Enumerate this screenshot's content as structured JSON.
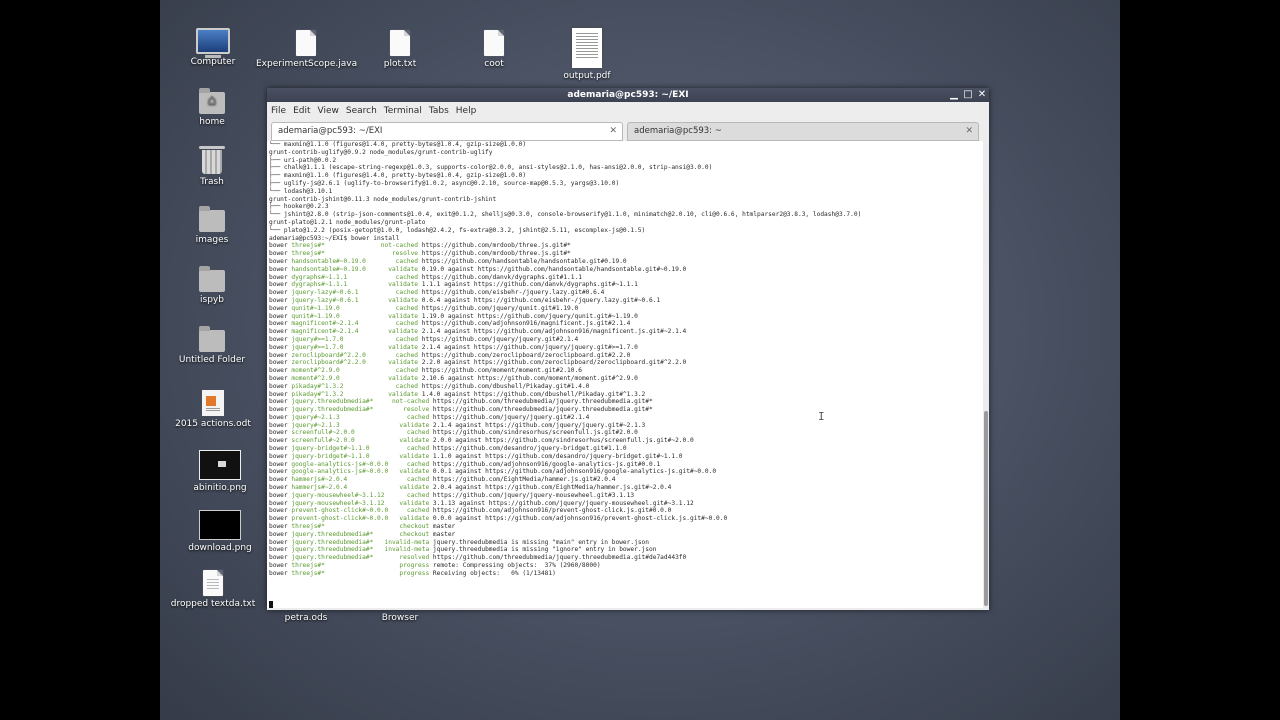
{
  "desktop": {
    "icons": [
      {
        "label": "Computer"
      },
      {
        "label": "home"
      },
      {
        "label": "Trash"
      },
      {
        "label": "images"
      },
      {
        "label": "ispyb"
      },
      {
        "label": "Untitled Folder"
      },
      {
        "label": "2015 actions.odt"
      },
      {
        "label": "abinitio.png"
      },
      {
        "label": "download.png"
      },
      {
        "label": "dropped textda.txt"
      },
      {
        "label": "ExperimentScope.java"
      },
      {
        "label": "plot.txt"
      },
      {
        "label": "coot"
      },
      {
        "label": "output.pdf"
      },
      {
        "label": "petra.ods"
      },
      {
        "label": "Browser"
      }
    ]
  },
  "window": {
    "title": "ademaria@pc593: ~/EXI",
    "controls": [
      "▁",
      "□",
      "✕"
    ],
    "menu": [
      "File",
      "Edit",
      "View",
      "Search",
      "Terminal",
      "Tabs",
      "Help"
    ],
    "tabs": [
      {
        "label": "ademaria@pc593: ~/EXI",
        "active": true
      },
      {
        "label": "ademaria@pc593: ~",
        "active": false
      }
    ]
  },
  "terminal": {
    "lines": [
      [
        "└── maxmin@1.1.0 (figures@1.4.0, pretty-bytes@1.0.4, gzip-size@1.0.0)",
        "",
        ""
      ],
      [
        "",
        "",
        ""
      ],
      [
        "grunt-contrib-uglify@0.9.2 node_modules/grunt-contrib-uglify",
        "",
        ""
      ],
      [
        "├── uri-path@0.0.2",
        "",
        ""
      ],
      [
        "├── chalk@1.1.1 (escape-string-regexp@1.0.3, supports-color@2.0.0, ansi-styles@2.1.0, has-ansi@2.0.0, strip-ansi@3.0.0)",
        "",
        ""
      ],
      [
        "├── maxmin@1.1.0 (figures@1.4.0, pretty-bytes@1.0.4, gzip-size@1.0.0)",
        "",
        ""
      ],
      [
        "├── uglify-js@2.6.1 (uglify-to-browserify@1.0.2, async@0.2.10, source-map@0.5.3, yargs@3.10.0)",
        "",
        ""
      ],
      [
        "└── lodash@3.10.1",
        "",
        ""
      ],
      [
        "",
        "",
        ""
      ],
      [
        "grunt-contrib-jshint@0.11.3 node_modules/grunt-contrib-jshint",
        "",
        ""
      ],
      [
        "├── hooker@0.2.3",
        "",
        ""
      ],
      [
        "└── jshint@2.8.0 (strip-json-comments@1.0.4, exit@0.1.2, shelljs@0.3.0, console-browserify@1.1.0, minimatch@2.0.10, cli@0.6.6, htmlparser2@3.8.3, lodash@3.7.0)",
        "",
        ""
      ],
      [
        "",
        "",
        ""
      ],
      [
        "grunt-plato@1.2.1 node_modules/grunt-plato",
        "",
        ""
      ],
      [
        "└── plato@1.2.2 (posix-getopt@1.0.0, lodash@2.4.2, fs-extra@0.3.2, jshint@2.5.11, escomplex-js@0.1.5)",
        "",
        ""
      ],
      [
        "ademaria@pc593:~/EXI$ bower install",
        "",
        ""
      ],
      [
        "bower ",
        "threejs#*               not-cached",
        " https://github.com/mrdoob/three.js.git#*"
      ],
      [
        "bower ",
        "threejs#*                  resolve",
        " https://github.com/mrdoob/three.js.git#*"
      ],
      [
        "bower ",
        "handsontable#~0.19.0        cached",
        " https://github.com/handsontable/handsontable.git#0.19.0"
      ],
      [
        "bower ",
        "handsontable#~0.19.0      validate",
        " 0.19.0 against https://github.com/handsontable/handsontable.git#~0.19.0"
      ],
      [
        "bower ",
        "dygraphs#~1.1.1             cached",
        " https://github.com/danvk/dygraphs.git#1.1.1"
      ],
      [
        "bower ",
        "dygraphs#~1.1.1           validate",
        " 1.1.1 against https://github.com/danvk/dygraphs.git#~1.1.1"
      ],
      [
        "bower ",
        "jquery-lazy#~0.6.1          cached",
        " https://github.com/eisbehr-/jquery.lazy.git#0.6.4"
      ],
      [
        "bower ",
        "jquery-lazy#~0.6.1        validate",
        " 0.6.4 against https://github.com/eisbehr-/jquery.lazy.git#~0.6.1"
      ],
      [
        "bower ",
        "qunit#~1.19.0               cached",
        " https://github.com/jquery/qunit.git#1.19.0"
      ],
      [
        "bower ",
        "qunit#~1.19.0             validate",
        " 1.19.0 against https://github.com/jquery/qunit.git#~1.19.0"
      ],
      [
        "bower ",
        "magnificent#~2.1.4          cached",
        " https://github.com/adjohnson916/magnificent.js.git#2.1.4"
      ],
      [
        "bower ",
        "magnificent#~2.1.4        validate",
        " 2.1.4 against https://github.com/adjohnson916/magnificent.js.git#~2.1.4"
      ],
      [
        "bower ",
        "jquery#>=1.7.0              cached",
        " https://github.com/jquery/jquery.git#2.1.4"
      ],
      [
        "bower ",
        "jquery#>=1.7.0            validate",
        " 2.1.4 against https://github.com/jquery/jquery.git#>=1.7.0"
      ],
      [
        "bower ",
        "zeroclipboard#^2.2.0        cached",
        " https://github.com/zeroclipboard/zeroclipboard.git#2.2.0"
      ],
      [
        "bower ",
        "zeroclipboard#^2.2.0      validate",
        " 2.2.0 against https://github.com/zeroclipboard/zeroclipboard.git#^2.2.0"
      ],
      [
        "bower ",
        "moment#^2.9.0               cached",
        " https://github.com/moment/moment.git#2.10.6"
      ],
      [
        "bower ",
        "moment#^2.9.0             validate",
        " 2.10.6 against https://github.com/moment/moment.git#^2.9.0"
      ],
      [
        "bower ",
        "pikaday#^1.3.2              cached",
        " https://github.com/dbushell/Pikaday.git#1.4.0"
      ],
      [
        "bower ",
        "pikaday#^1.3.2            validate",
        " 1.4.0 against https://github.com/dbushell/Pikaday.git#^1.3.2"
      ],
      [
        "bower ",
        "jquery.threedubmedia#*     not-cached",
        " https://github.com/threedubmedia/jquery.threedubmedia.git#*"
      ],
      [
        "bower ",
        "jquery.threedubmedia#*        resolve",
        " https://github.com/threedubmedia/jquery.threedubmedia.git#*"
      ],
      [
        "bower ",
        "jquery#~2.1.3                  cached",
        " https://github.com/jquery/jquery.git#2.1.4"
      ],
      [
        "bower ",
        "jquery#~2.1.3                validate",
        " 2.1.4 against https://github.com/jquery/jquery.git#~2.1.3"
      ],
      [
        "bower ",
        "screenfull#~2.0.0              cached",
        " https://github.com/sindresorhus/screenfull.js.git#2.0.0"
      ],
      [
        "bower ",
        "screenfull#~2.0.0            validate",
        " 2.0.0 against https://github.com/sindresorhus/screenfull.js.git#~2.0.0"
      ],
      [
        "bower ",
        "jquery-bridget#~1.1.0          cached",
        " https://github.com/desandro/jquery-bridget.git#1.1.0"
      ],
      [
        "bower ",
        "jquery-bridget#~1.1.0        validate",
        " 1.1.0 against https://github.com/desandro/jquery-bridget.git#~1.1.0"
      ],
      [
        "bower ",
        "google-analytics-js#~0.0.0     cached",
        " https://github.com/adjohnson916/google-analytics-js.git#0.0.1"
      ],
      [
        "bower ",
        "google-analytics-js#~0.0.0   validate",
        " 0.0.1 against https://github.com/adjohnson916/google-analytics-js.git#~0.0.0"
      ],
      [
        "bower ",
        "hammerjs#~2.0.4                cached",
        " https://github.com/EightMedia/hammer.js.git#2.0.4"
      ],
      [
        "bower ",
        "hammerjs#~2.0.4              validate",
        " 2.0.4 against https://github.com/EightMedia/hammer.js.git#~2.0.4"
      ],
      [
        "bower ",
        "jquery-mousewheel#~3.1.12      cached",
        " https://github.com/jquery/jquery-mousewheel.git#3.1.13"
      ],
      [
        "bower ",
        "jquery-mousewheel#~3.1.12    validate",
        " 3.1.13 against https://github.com/jquery/jquery-mousewheel.git#~3.1.12"
      ],
      [
        "bower ",
        "prevent-ghost-click#~0.0.0     cached",
        " https://github.com/adjohnson916/prevent-ghost-click.js.git#0.0.0"
      ],
      [
        "bower ",
        "prevent-ghost-click#~0.0.0   validate",
        " 0.0.0 against https://github.com/adjohnson916/prevent-ghost-click.js.git#~0.0.0"
      ],
      [
        "bower ",
        "threejs#*                    checkout",
        " master"
      ],
      [
        "bower ",
        "jquery.threedubmedia#*       checkout",
        " master"
      ],
      [
        "bower ",
        "jquery.threedubmedia#*   invalid-meta",
        " jquery.threedubmedia is missing \"main\" entry in bower.json"
      ],
      [
        "bower ",
        "jquery.threedubmedia#*   invalid-meta",
        " jquery.threedubmedia is missing \"ignore\" entry in bower.json"
      ],
      [
        "bower ",
        "jquery.threedubmedia#*       resolved",
        " https://github.com/threedubmedia/jquery.threedubmedia.git#de7ad443f0"
      ],
      [
        "bower ",
        "threejs#*                    progress",
        " remote: Compressing objects:  37% (2960/8000)"
      ],
      [
        "bower ",
        "threejs#*                    progress",
        " Receiving objects:   0% (1/13481)"
      ]
    ]
  }
}
